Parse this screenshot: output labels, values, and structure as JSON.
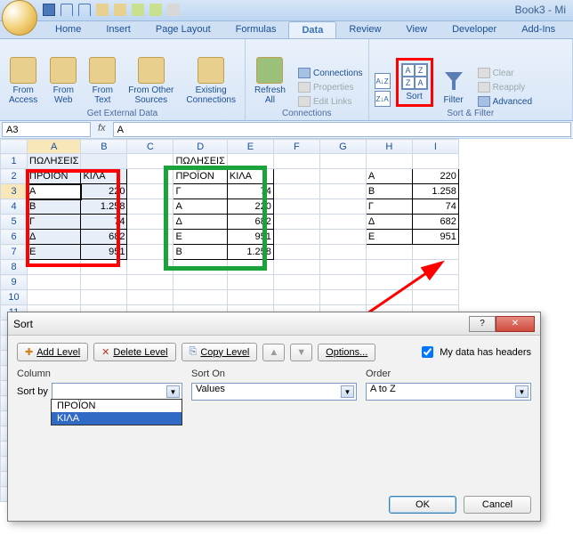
{
  "window": {
    "title": "Book3 - Mi"
  },
  "tabs": [
    "Home",
    "Insert",
    "Page Layout",
    "Formulas",
    "Data",
    "Review",
    "View",
    "Developer",
    "Add-Ins"
  ],
  "active_tab": "Data",
  "ribbon": {
    "group1": {
      "label": "Get External Data",
      "btns": [
        "From\nAccess",
        "From\nWeb",
        "From\nText",
        "From Other\nSources",
        "Existing\nConnections"
      ]
    },
    "group2": {
      "label": "Connections",
      "refresh": "Refresh\nAll",
      "items": [
        "Connections",
        "Properties",
        "Edit Links"
      ]
    },
    "group3": {
      "label": "Sort & Filter",
      "sort": "Sort",
      "filter": "Filter",
      "items": [
        "Clear",
        "Reapply",
        "Advanced"
      ]
    }
  },
  "namebox": "A3",
  "formula": "A",
  "columns": [
    "A",
    "B",
    "C",
    "D",
    "E",
    "F",
    "G",
    "H",
    "I"
  ],
  "row_count": 23,
  "sheet": {
    "r1": {
      "A": "ΠΩΛΗΣΕΙΣ",
      "D": "ΠΩΛΗΣΕΙΣ"
    },
    "r2": {
      "A": "ΠΡΟΪΟΝ",
      "B": "ΚΙΛΑ",
      "D": "ΠΡΟΪΟΝ",
      "E": "ΚΙΛΑ",
      "H": "Α",
      "I": "220"
    },
    "r3": {
      "A": "Α",
      "B": "220",
      "D": "Γ",
      "E": "74",
      "H": "Β",
      "I": "1.258"
    },
    "r4": {
      "A": "Β",
      "B": "1.258",
      "D": "Α",
      "E": "220",
      "H": "Γ",
      "I": "74"
    },
    "r5": {
      "A": "Γ",
      "B": "74",
      "D": "Δ",
      "E": "682",
      "H": "Δ",
      "I": "682"
    },
    "r6": {
      "A": "Δ",
      "B": "682",
      "D": "Ε",
      "E": "951",
      "H": "Ε",
      "I": "951"
    },
    "r7": {
      "A": "Ε",
      "B": "951",
      "D": "Β",
      "E": "1.258"
    }
  },
  "dialog": {
    "title": "Sort",
    "add": "Add Level",
    "delete": "Delete Level",
    "copy": "Copy Level",
    "options": "Options...",
    "headers": "My data has headers",
    "col_hdr": "Column",
    "sorton_hdr": "Sort On",
    "order_hdr": "Order",
    "sortby": "Sort by",
    "sorton_val": "Values",
    "order_val": "A to Z",
    "ok": "OK",
    "cancel": "Cancel",
    "dropdown": [
      "ΠΡΟΪΟΝ",
      "ΚΙΛΑ"
    ]
  }
}
